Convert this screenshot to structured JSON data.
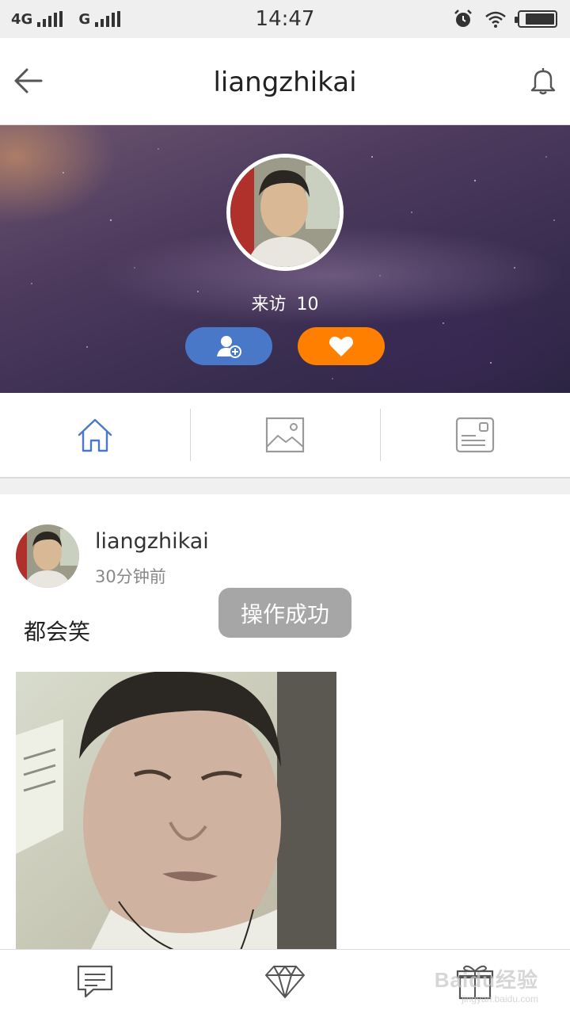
{
  "status_bar": {
    "network_1": "4G",
    "network_2": "G",
    "time": "14:47",
    "battery_level": 0.85
  },
  "header": {
    "title": "liangzhikai",
    "back_icon": "arrow-left-icon",
    "bell_icon": "bell-icon"
  },
  "profile": {
    "visits_label": "来访",
    "visits_count": "10",
    "follow_icon": "add-user-icon",
    "like_icon": "heart-icon",
    "follow_color": "#4a78c8",
    "like_color": "#ff8000"
  },
  "tabs": [
    {
      "icon": "home-icon",
      "active": true
    },
    {
      "icon": "image-icon",
      "active": false
    },
    {
      "icon": "profile-card-icon",
      "active": false
    }
  ],
  "post": {
    "username": "liangzhikai",
    "time": "30分钟前",
    "text": "都会笑"
  },
  "toast": "操作成功",
  "bottom_nav": [
    {
      "icon": "message-icon"
    },
    {
      "icon": "diamond-icon"
    },
    {
      "icon": "gift-icon"
    }
  ],
  "watermark": {
    "text": "Baidu经验",
    "sub": "jingyan.baidu.com"
  },
  "colors": {
    "accent": "#4a78c8",
    "like": "#ff8000"
  }
}
